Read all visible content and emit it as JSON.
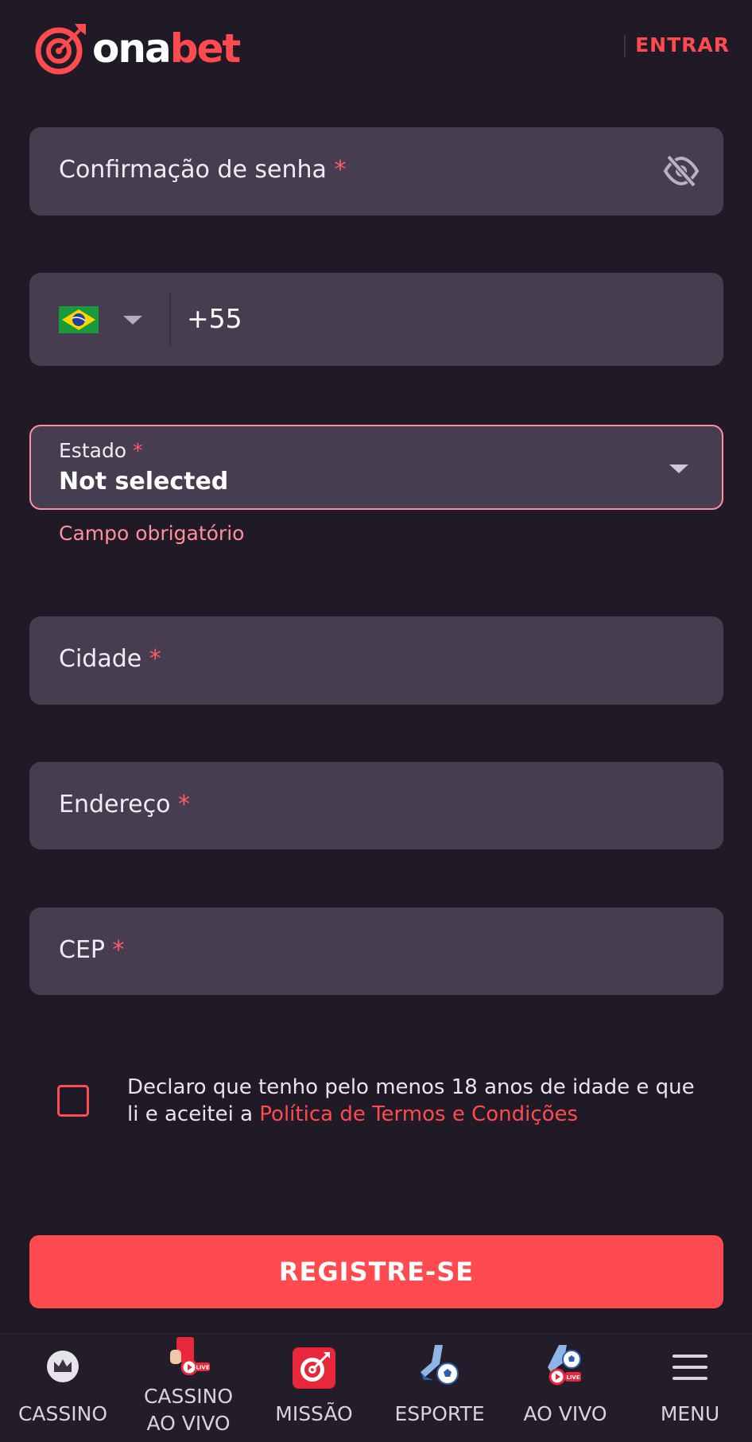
{
  "header": {
    "logo_text_white": "ona",
    "logo_text_red": "bet",
    "login_label": "ENTRAR"
  },
  "form": {
    "confirm_password": {
      "label": "Confirmação de senha",
      "required_mark": "*"
    },
    "phone": {
      "country_flag": "brazil-flag-icon",
      "value": "+55"
    },
    "state": {
      "label": "Estado",
      "required_mark": "*",
      "value": "Not selected",
      "error": "Campo obrigatório"
    },
    "city": {
      "label": "Cidade",
      "required_mark": "*"
    },
    "address": {
      "label": "Endereço",
      "required_mark": "*"
    },
    "zip": {
      "label": "CEP",
      "required_mark": "*"
    },
    "consent": {
      "text_line1": "Declaro que tenho pelo menos 18 anos de idade e que",
      "text_line2": "li e aceitei a ",
      "link": "Política de Termos e Condições"
    },
    "register_label": "REGISTRE-SE"
  },
  "bottom_nav": {
    "items": [
      {
        "label": "CASSINO",
        "icon": "crown-icon"
      },
      {
        "label_line1": "CASSINO",
        "label_line2": "AO VIVO",
        "icon": "live-casino-icon"
      },
      {
        "label": "MISSÃO",
        "icon": "target-icon"
      },
      {
        "label": "ESPORTE",
        "icon": "soccer-icon"
      },
      {
        "label": "AO VIVO",
        "icon": "live-sport-icon"
      },
      {
        "label": "MENU",
        "icon": "hamburger-icon"
      }
    ]
  },
  "colors": {
    "background": "#1f1a26",
    "field": "#463e50",
    "accent": "#ff4a4f",
    "error": "#ff8f9c"
  }
}
